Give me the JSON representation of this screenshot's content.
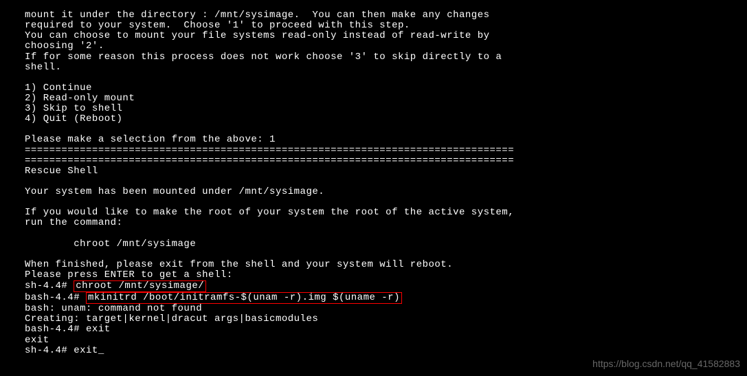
{
  "terminal": {
    "line1": "mount it under the directory : /mnt/sysimage.  You can then make any changes",
    "line2": "required to your system.  Choose '1' to proceed with this step.",
    "line3": "You can choose to mount your file systems read-only instead of read-write by",
    "line4": "choosing '2'.",
    "line5": "If for some reason this process does not work choose '3' to skip directly to a",
    "line6": "shell.",
    "line7": "",
    "line8": "1) Continue",
    "line9": "2) Read-only mount",
    "line10": "3) Skip to shell",
    "line11": "4) Quit (Reboot)",
    "line12": "",
    "line13": "Please make a selection from the above: 1",
    "line14": "================================================================================",
    "line15": "================================================================================",
    "line16": "Rescue Shell",
    "line17": "",
    "line18": "Your system has been mounted under /mnt/sysimage.",
    "line19": "",
    "line20": "If you would like to make the root of your system the root of the active system,",
    "line21": "run the command:",
    "line22": "",
    "line23": "        chroot /mnt/sysimage",
    "line24": "",
    "line25": "When finished, please exit from the shell and your system will reboot.",
    "line26": "Please press ENTER to get a shell:",
    "line27_prefix": "sh-4.4# ",
    "line27_cmd": "chroot /mnt/sysimage/",
    "line28_prefix": "bash-4.4# ",
    "line28_cmd": "mkinitrd /boot/initramfs-$(unam -r).img $(uname -r)",
    "line29": "bash: unam: command not found",
    "line30": "Creating: target|kernel|dracut args|basicmodules",
    "line31": "bash-4.4# exit",
    "line32": "exit",
    "line33": "sh-4.4# exit_"
  },
  "watermark": "https://blog.csdn.net/qq_41582883"
}
